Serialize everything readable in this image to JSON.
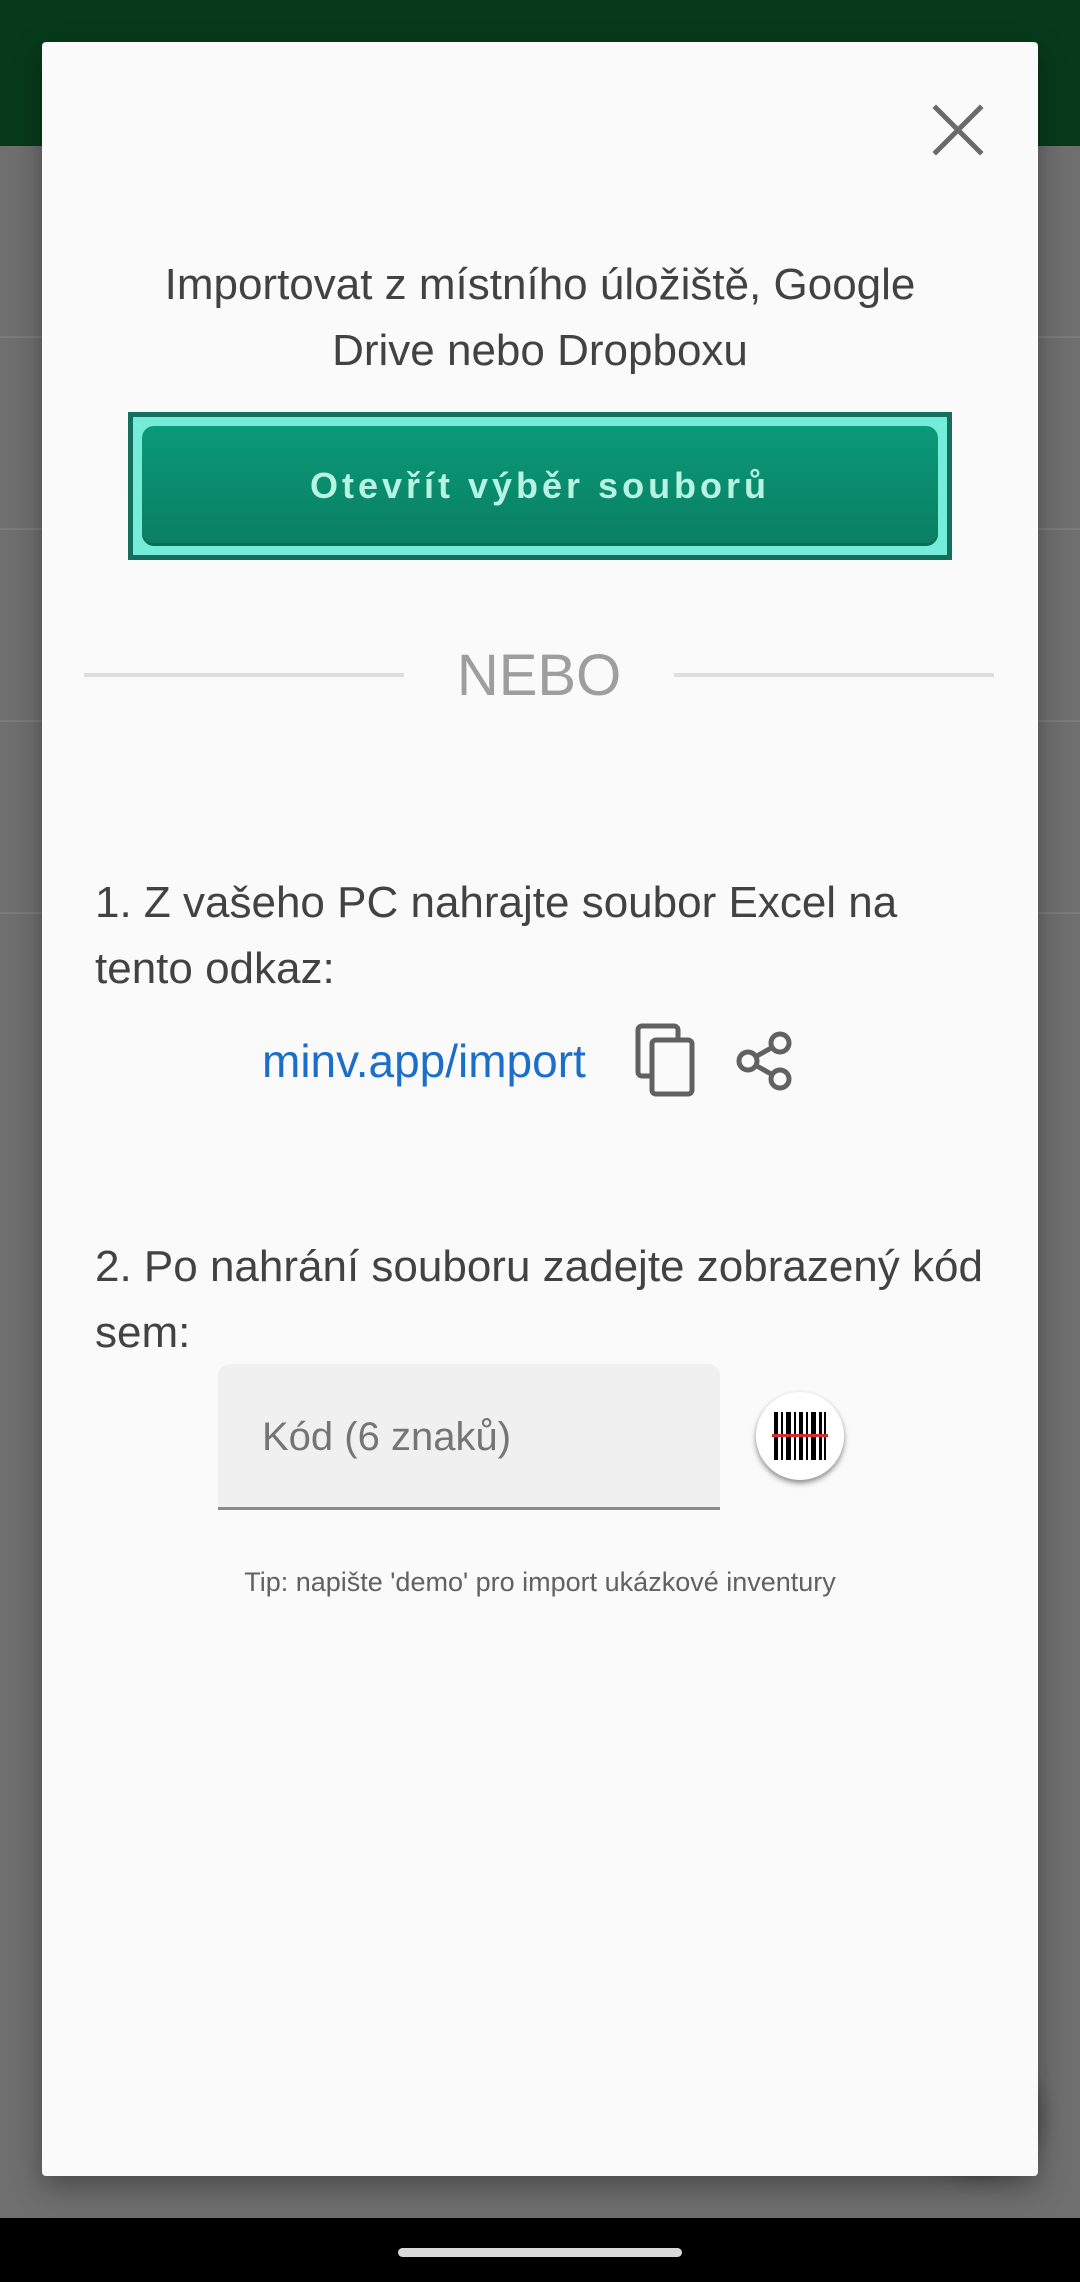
{
  "dialog": {
    "heading": "Importovat z místního úložiště, Google Drive nebo Dropboxu",
    "open_picker_label": "Otevřít výběr souborů",
    "or_label": "NEBO",
    "step1_text": "1. Z vašeho PC nahrajte soubor Excel na tento odkaz:",
    "import_link": "minv.app/import",
    "step2_text": "2. Po nahrání souboru zadejte zobrazený kód sem:",
    "code_placeholder": "Kód (6 znaků)",
    "tip": "Tip: napište 'demo' pro import ukázkové inventury"
  },
  "icons": {
    "close": "close-icon",
    "copy": "copy-icon",
    "share": "share-icon",
    "scan": "barcode-scan-icon"
  },
  "colors": {
    "accent": "#0a8a6c",
    "link": "#1c6fc9",
    "appbar": "#073a1b"
  }
}
